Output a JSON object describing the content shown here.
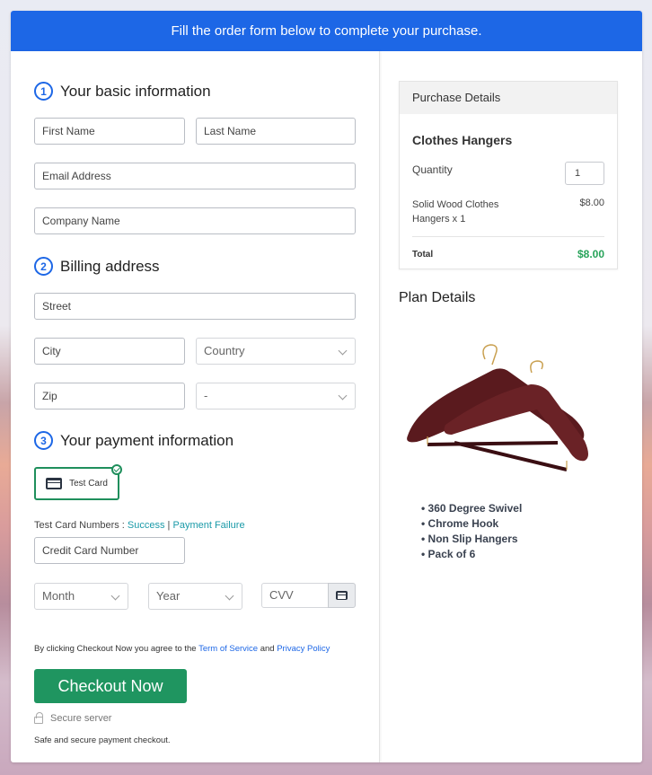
{
  "banner": {
    "text": "Fill the order form below to complete your purchase."
  },
  "sections": {
    "basic": {
      "number": "1",
      "title": "Your basic information"
    },
    "billing": {
      "number": "2",
      "title": "Billing address"
    },
    "payment": {
      "number": "3",
      "title": "Your payment information"
    }
  },
  "fields": {
    "first_name": "First Name",
    "last_name": "Last Name",
    "email": "Email Address",
    "company": "Company Name",
    "street": "Street",
    "city": "City",
    "country": "Country",
    "zip": "Zip",
    "state": "-",
    "card_number": "Credit Card Number",
    "month": "Month",
    "year": "Year",
    "cvv": "CVV"
  },
  "payment": {
    "method_label": "Test Card",
    "test_numbers_label": "Test Card Numbers : ",
    "success_link": "Success",
    "separator": " | ",
    "failure_link": "Payment Failure"
  },
  "agreement": {
    "prefix": "By clicking Checkout Now you agree to the ",
    "terms": "Term of Service",
    "and": " and ",
    "privacy": "Privacy Policy"
  },
  "checkout": {
    "button": "Checkout Now",
    "secure": "Secure server",
    "safe": "Safe and secure payment checkout."
  },
  "purchase": {
    "header": "Purchase Details",
    "product": "Clothes Hangers",
    "quantity_label": "Quantity",
    "quantity_value": "1",
    "item": "Solid Wood Clothes Hangers x 1",
    "item_price": "$8.00",
    "total_label": "Total",
    "total_value": "$8.00"
  },
  "plan": {
    "title": "Plan Details",
    "image": "wooden-clothes-hangers",
    "features": [
      "360 Degree Swivel",
      "Chrome Hook",
      "Non Slip Hangers",
      "Pack of 6"
    ]
  },
  "colors": {
    "banner": "#1d67e6",
    "checkout": "#1f9560",
    "total": "#28a35a",
    "link": "#1a9aa8"
  }
}
